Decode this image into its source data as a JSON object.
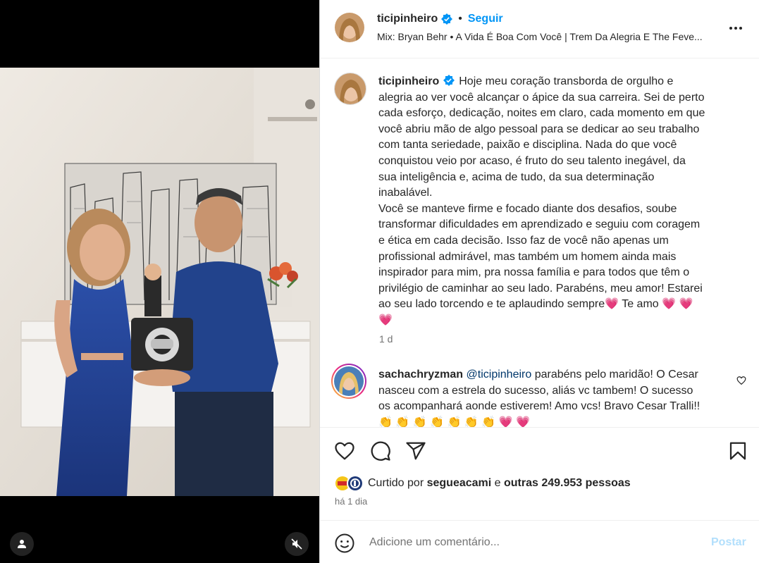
{
  "header": {
    "username": "ticipinheiro",
    "verified_icon": "verified-badge-icon",
    "dot": "•",
    "follow_label": "Seguir",
    "music": "Mix: Bryan Behr • A Vida É Boa Com Você | Trem Da Alegria E The Feve..."
  },
  "caption": {
    "username": "ticipinheiro",
    "lines": [
      "Hoje meu coração transborda de orgulho e",
      "alegria ao ver você alcançar o ápice da sua carreira. Sei de perto",
      "cada esforço, dedicação, noites em claro, cada momento em que",
      "você abriu mão de algo pessoal para se dedicar ao seu trabalho",
      "com tanta seriedade, paixão e disciplina. Nada do que você",
      "conquistou veio por acaso, é fruto do seu talento inegável, da",
      "sua inteligência e, acima de tudo, da sua determinação",
      "inabalável.",
      "Você se manteve firme e focado diante dos desafios, soube",
      "transformar dificuldades em aprendizado e seguiu com coragem",
      "e ética em cada decisão. Isso faz de você não apenas um",
      "profissional admirável, mas também um homem ainda mais",
      "inspirador para mim, pra nossa família e para todos que têm o",
      "privilégio de caminhar ao seu lado. Parabéns, meu amor! Estarei",
      "ao seu lado torcendo e te aplaudindo sempre💗  Te amo  💗 💗",
      "💗"
    ],
    "time": "1 d"
  },
  "comment": {
    "username": "sachachryzman",
    "mention": "@ticipinheiro",
    "line1_rest": " parabéns pelo maridão! O Cesar",
    "lines": [
      "nasceu com a estrela do sucesso, aliás vc tambem! O sucesso",
      "os acompanhará aonde estiverem! Amo vcs! Bravo Cesar Tralli!!",
      "👏 👏 👏 👏 👏 👏 👏 💗 💗"
    ]
  },
  "likes": {
    "prefix": "Curtido por ",
    "user": "segueacami",
    "middle": " e ",
    "others": "outras 249.953 pessoas"
  },
  "post_date": "há 1 dia",
  "add_comment": {
    "placeholder": "Adicione um comentário...",
    "post_label": "Postar"
  },
  "colors": {
    "accent": "#0095f6",
    "post_disabled": "#b2dffc",
    "secondary_text": "#737373",
    "mention": "#00376b"
  }
}
